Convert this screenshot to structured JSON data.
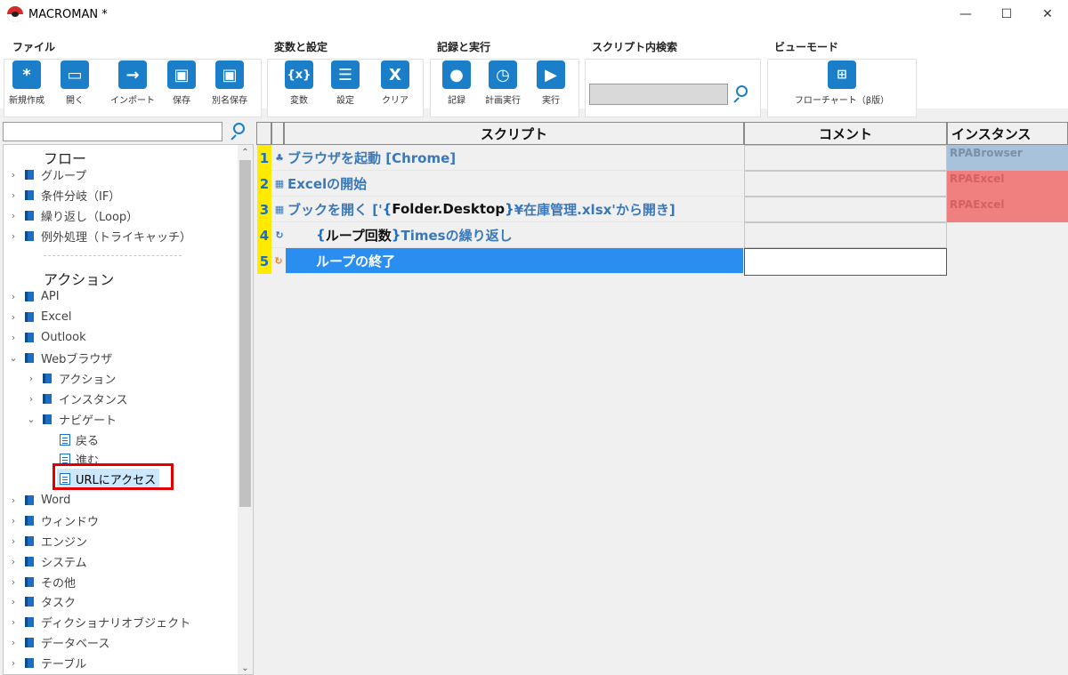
{
  "window": {
    "title": "MACROMAN *",
    "controls": [
      "—",
      "☐",
      "✕"
    ]
  },
  "ribbon": {
    "file_group": {
      "title": "ファイル",
      "buttons": [
        {
          "label": "新規作成",
          "icon": "asterisk-icon",
          "glyph": "*"
        },
        {
          "label": "開く",
          "icon": "folder-icon",
          "glyph": "▭"
        },
        {
          "label": "インポート",
          "icon": "import-arrow-icon",
          "glyph": "→"
        },
        {
          "label": "保存",
          "icon": "floppy-icon",
          "glyph": "▣"
        },
        {
          "label": "別名保存",
          "icon": "floppy-star-icon",
          "glyph": "▣"
        }
      ]
    },
    "var_group": {
      "title": "変数と設定",
      "buttons": [
        {
          "label": "変数",
          "icon": "variable-icon",
          "glyph": "{x}"
        },
        {
          "label": "設定",
          "icon": "list-icon",
          "glyph": "☰"
        },
        {
          "label": "クリア",
          "icon": "clear-x-icon",
          "glyph": "X"
        }
      ]
    },
    "rec_group": {
      "title": "記録と実行",
      "buttons": [
        {
          "label": "記録",
          "icon": "record-icon",
          "glyph": "●"
        },
        {
          "label": "計画実行",
          "icon": "schedule-icon",
          "glyph": "◷"
        },
        {
          "label": "実行",
          "icon": "play-icon",
          "glyph": "▶"
        }
      ]
    },
    "search_group": {
      "title": "スクリプト内検索",
      "value": ""
    },
    "view_group": {
      "title": "ビューモード",
      "button_label": "フローチャート（β版）",
      "icon": "flowchart-icon"
    }
  },
  "left_panel": {
    "search_value": "",
    "flow_heading": "フロー",
    "flow_items": [
      "グループ",
      "条件分岐（IF）",
      "繰り返し（Loop）",
      "例外処理（トライキャッチ）"
    ],
    "action_heading": "アクション",
    "action_items_top": [
      "API",
      "Excel",
      "Outlook",
      "Webブラウザ"
    ],
    "web_children": [
      "アクション",
      "インスタンス",
      "ナビゲート"
    ],
    "nav_children": [
      "戻る",
      "進む",
      "URLにアクセス"
    ],
    "action_items_bottom": [
      "Word",
      "ウィンドウ",
      "エンジン",
      "システム",
      "その他",
      "タスク",
      "ディクショナリオブジェクト",
      "データベース",
      "テーブル"
    ]
  },
  "grid": {
    "headers": {
      "script": "スクリプト",
      "comment": "コメント",
      "instance": "インスタンス"
    },
    "rows": [
      {
        "num": "1",
        "text": "ブラウザを起動 [Chrome]",
        "instance": "RPABrowser"
      },
      {
        "num": "2",
        "text": "Excelの開始",
        "instance": "RPAExcel"
      },
      {
        "num": "3",
        "text_pre": "ブックを開く ['",
        "brace_open": "{",
        "var": "Folder.Desktop",
        "brace_close": "}",
        "text_post": "¥在庫管理.xlsx'から開き]",
        "instance": "RPAExcel"
      },
      {
        "num": "4",
        "brace_open": "{",
        "var": "ループ回数",
        "brace_close": "}",
        "text_post": " Timesの繰り返し",
        "instance": ""
      },
      {
        "num": "5",
        "text": "ループの終了",
        "instance": ""
      }
    ]
  },
  "colors": {
    "accent": "#1a7fc8",
    "line_number_bg": "#ffea00",
    "selected_row": "#2a8ef0",
    "browser_instance": "#a9c2dc",
    "excel_instance": "#f08080",
    "highlight_border": "#e00000"
  }
}
